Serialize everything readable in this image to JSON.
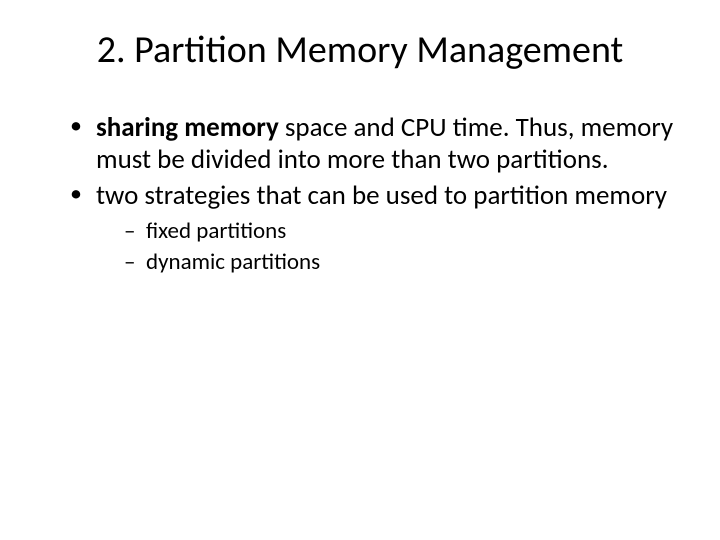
{
  "title": "2. Partition Memory Management",
  "bullets": [
    {
      "bold": "sharing memory ",
      "rest": "space and CPU time. Thus, memory must be divided into more than two partitions."
    },
    {
      "bold": "",
      "rest": "two strategies that can be used to partition memory"
    }
  ],
  "subbullets": [
    "fixed partitions",
    "dynamic partitions"
  ]
}
